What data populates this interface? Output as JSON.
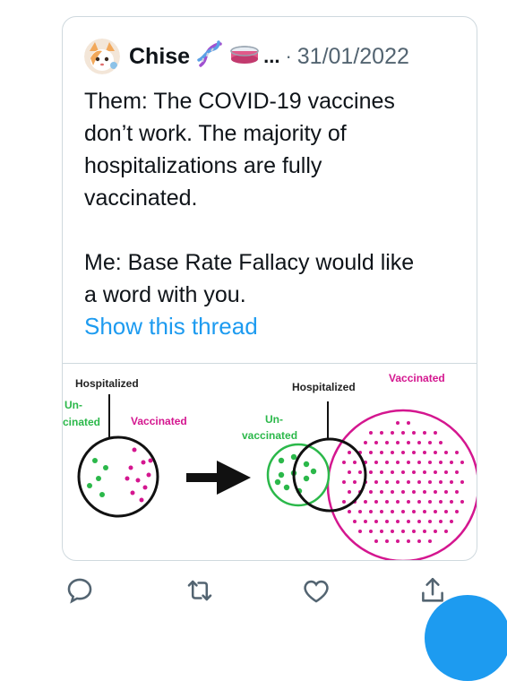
{
  "tweet": {
    "author_name": "Chise",
    "ellipsis": "...",
    "separator": "·",
    "date": "31/01/2022",
    "body_lines": [
      "Them: The COVID-19 vaccines",
      "don’t work. The majority of",
      "hospitalizations are fully",
      "vaccinated.",
      "Me: Base Rate Fallacy would like",
      "a word with you."
    ],
    "show_thread": "Show this thread"
  },
  "media": {
    "left_hospitalized": "Hospitalized",
    "left_un_line1": "Un-",
    "left_un_line2": "cinated",
    "left_vaccinated": "Vaccinated",
    "right_hospitalized": "Hospitalized",
    "right_vaccinated": "Vaccinated",
    "right_un_line1": "Un-",
    "right_un_line2": "vaccinated"
  },
  "colors": {
    "accent": "#1d9bf0",
    "green": "#2bb84a",
    "magenta": "#d4168f",
    "text": "#0f1419",
    "muted": "#536471"
  },
  "icons": [
    "reply-icon",
    "retweet-icon",
    "like-icon",
    "share-icon",
    "dna-emoji",
    "petri-dish-emoji"
  ]
}
